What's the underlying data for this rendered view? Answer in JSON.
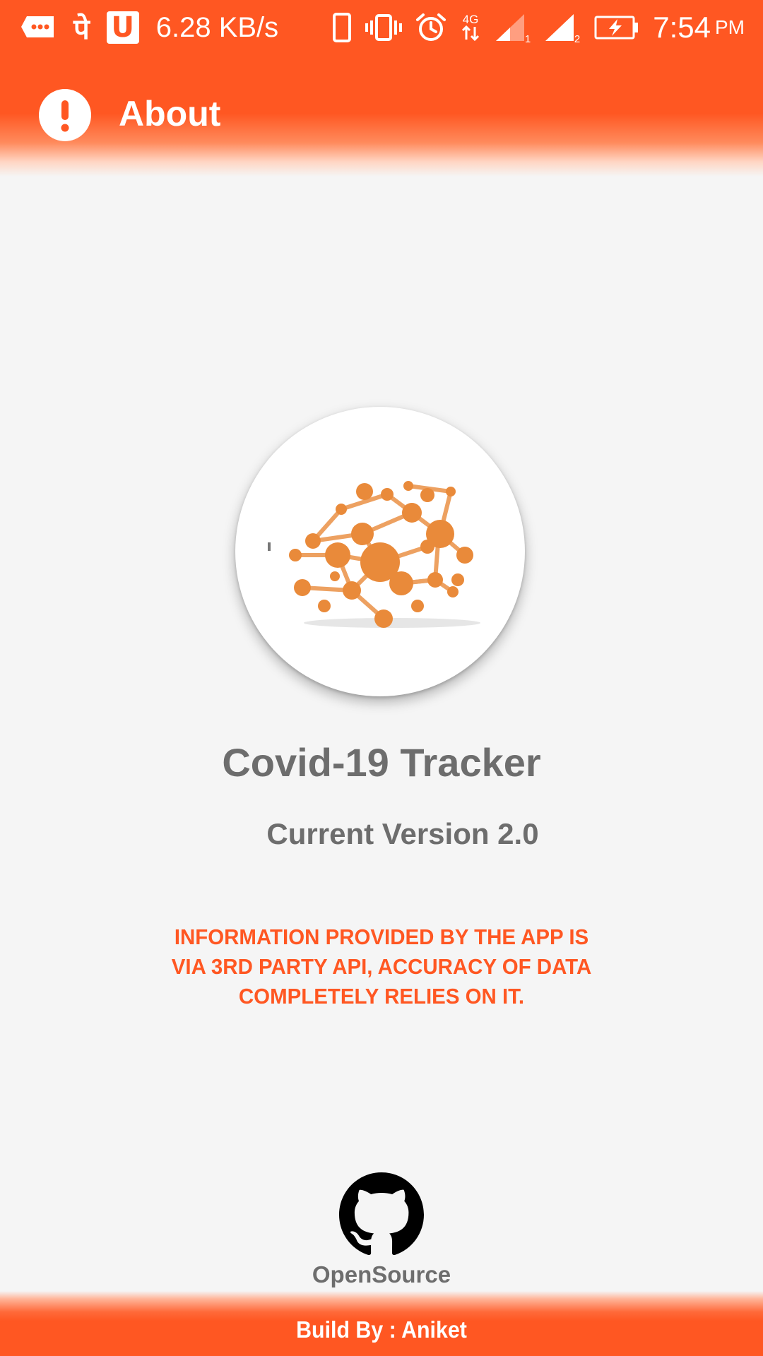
{
  "status_bar": {
    "network_speed": "6.28 KB/s",
    "hindi_glyph": "पे",
    "u_glyph": "U",
    "network_type": "4G",
    "sim1": "1",
    "sim2": "2",
    "clock_time": "7:54",
    "clock_period": "PM",
    "icons": [
      "message-dots-icon",
      "phonepe-icon",
      "u-app-icon",
      "phone-outline-icon",
      "vibrate-icon",
      "alarm-icon",
      "network-4g-icon",
      "signal-sim1-icon",
      "signal-sim2-icon",
      "battery-charging-icon"
    ]
  },
  "toolbar": {
    "icon": "alert-circle-icon",
    "title": "About"
  },
  "app": {
    "logo_icon": "virus-globe-icon",
    "name": "Covid-19 Tracker",
    "version": "Current Version 2.0",
    "disclaimer": "INFORMATION PROVIDED BY THE APP IS VIA 3RD PARTY API, ACCURACY OF DATA COMPLETELY RELIES ON IT."
  },
  "footer": {
    "github_icon": "github-icon",
    "opensource_label": "OpenSource",
    "credit": "Build By : Aniket"
  },
  "colors": {
    "primary": "#ff5722",
    "background": "#f5f5f5",
    "text_gray": "#6d6d6d",
    "logo_orange": "#e98a3a",
    "white": "#ffffff"
  }
}
